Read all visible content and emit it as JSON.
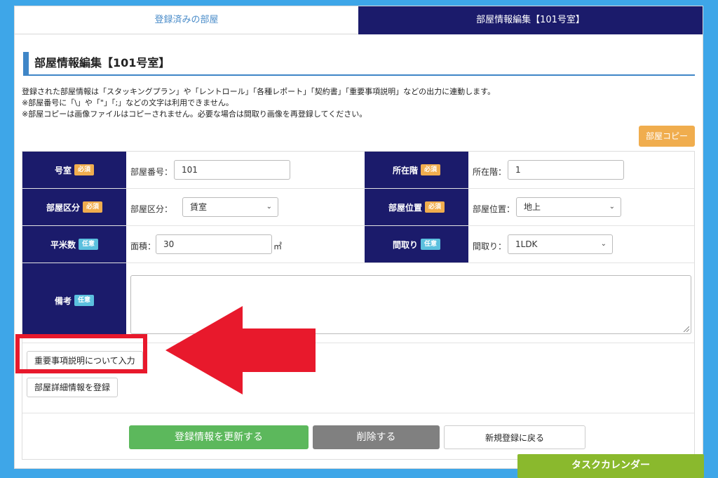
{
  "tabs": {
    "registered": "登録済みの部屋",
    "edit": "部屋情報編集【101号室】"
  },
  "section_title": "部屋情報編集【101号室】",
  "description": [
    "登録された部屋情報は「スタッキングプラン」や「レントロール」「各種レポート」「契約書」「重要事項説明」などの出力に連動します。",
    "※部屋番号に「\\」や「\"」「;」などの文字は利用できません。",
    "※部屋コピーは画像ファイルはコピーされません。必要な場合は間取り画像を再登録してください。"
  ],
  "copy_button": "部屋コピー",
  "badges": {
    "required": "必須",
    "optional": "任意"
  },
  "fields": {
    "room_no": {
      "label": "号室",
      "field_label": "部屋番号：",
      "value": "101"
    },
    "floor": {
      "label": "所在階",
      "field_label": "所在階：",
      "value": "1"
    },
    "room_type": {
      "label": "部屋区分",
      "field_label": "部屋区分：",
      "value": "賃室"
    },
    "position": {
      "label": "部屋位置",
      "field_label": "部屋位置：",
      "value": "地上"
    },
    "area": {
      "label": "平米数",
      "field_label": "面積：",
      "value": "30",
      "unit": "㎡"
    },
    "layout": {
      "label": "間取り",
      "field_label": "間取り：",
      "value": "1LDK"
    },
    "remarks": {
      "label": "備考",
      "value": ""
    }
  },
  "buttons": {
    "important_matters": "重要事項説明について入力",
    "room_details": "部屋詳細情報を登録",
    "update": "登録情報を更新する",
    "delete": "削除する",
    "back": "新規登録に戻る"
  },
  "task_calendar": "タスクカレンダー",
  "colors": {
    "navy": "#1b1b6b",
    "accent_blue": "#3f86c7",
    "required_badge": "#f0ad4e",
    "optional_badge": "#5bc0de",
    "update_green": "#5cb85c",
    "annotation_red": "#e8192c",
    "calendar_green": "#8ab92d"
  }
}
